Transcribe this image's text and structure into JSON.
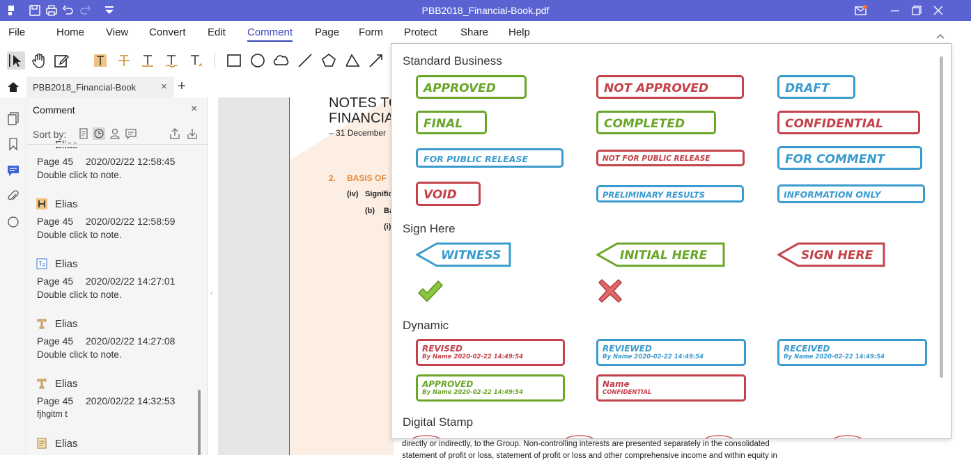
{
  "window": {
    "title": "PBB2018_Financial-Book.pdf"
  },
  "menu": {
    "items": [
      "File",
      "Home",
      "View",
      "Convert",
      "Edit",
      "Comment",
      "Page",
      "Form",
      "Protect",
      "Share",
      "Help"
    ],
    "active": "Comment"
  },
  "tabs": {
    "doc_tab": "PBB2018_Financial-Book",
    "close": "×",
    "add": "+"
  },
  "panel": {
    "title": "Comment",
    "close": "×",
    "sort_by": "Sort by:",
    "comments": [
      {
        "author": "Elias",
        "page": "Page 45",
        "time": "2020/02/22 12:58:45",
        "note": "Double click to note.",
        "icon": "highlight-icon"
      },
      {
        "author": "Elias",
        "page": "Page 45",
        "time": "2020/02/22 12:58:59",
        "note": "Double click to note.",
        "icon": "highlight-icon"
      },
      {
        "author": "Elias",
        "page": "Page 45",
        "time": "2020/02/22 14:27:01",
        "note": "Double click to note.",
        "icon": "textbox-icon"
      },
      {
        "author": "Elias",
        "page": "Page 45",
        "time": "2020/02/22 14:27:08",
        "note": "Double click to note.",
        "icon": "text-markup-icon"
      },
      {
        "author": "Elias",
        "page": "Page 45",
        "time": "2020/02/22 14:32:53",
        "note": "fjhgitm t",
        "icon": "text-markup-icon"
      },
      {
        "author": "Elias",
        "icon": "note-icon"
      }
    ]
  },
  "document": {
    "heading1": "NOTES TO",
    "heading2": "FINANCIA",
    "date_line": "– 31 December",
    "section_num": "2.",
    "section_title": "BASIS OF",
    "item_iv": "(iv)",
    "item_iv_text": "Signific",
    "item_b": "(b)",
    "item_b_text": "Ba",
    "item_i": "(i)",
    "bottom_line1": "directly or indirectly, to the Group. Non-controlling interests are presented separately in the consolidated",
    "bottom_line2": "statement of profit or loss, statement of profit or loss and other comprehensive income and within equity in"
  },
  "stamps": {
    "standard_business_title": "Standard Business",
    "standard": [
      {
        "label": "APPROVED",
        "color": "#6aa628"
      },
      {
        "label": "NOT APPROVED",
        "color": "#c4424a"
      },
      {
        "label": "DRAFT",
        "color": "#3a9bcf"
      },
      {
        "label": "FINAL",
        "color": "#6aa628"
      },
      {
        "label": "COMPLETED",
        "color": "#6aa628"
      },
      {
        "label": "CONFIDENTIAL",
        "color": "#c4424a"
      },
      {
        "label": "FOR PUBLIC RELEASE",
        "color": "#3a9bcf"
      },
      {
        "label": "NOT FOR PUBLIC RELEASE",
        "color": "#c4424a"
      },
      {
        "label": "FOR COMMENT",
        "color": "#3a9bcf"
      },
      {
        "label": "VOID",
        "color": "#c4424a"
      },
      {
        "label": "PRELIMINARY RESULTS",
        "color": "#3a9bcf"
      },
      {
        "label": "INFORMATION ONLY",
        "color": "#3a9bcf"
      }
    ],
    "sign_here_title": "Sign Here",
    "sign": [
      {
        "label": "WITNESS",
        "color": "#3a9bcf"
      },
      {
        "label": "INITIAL HERE",
        "color": "#6aa628"
      },
      {
        "label": "SIGN HERE",
        "color": "#c4424a"
      }
    ],
    "dynamic_title": "Dynamic",
    "dynamic": [
      {
        "label": "REVISED",
        "sub": "By Name 2020-02-22 14:49:54",
        "color": "#c4424a"
      },
      {
        "label": "REVIEWED",
        "sub": "By Name 2020-02-22 14:49:54",
        "color": "#3a9bcf"
      },
      {
        "label": "RECEIVED",
        "sub": "By Name 2020-02-22 14:49:54",
        "color": "#3a9bcf"
      },
      {
        "label": "APPROVED",
        "sub": "By Name 2020-02-22 14:49:54",
        "color": "#6aa628"
      },
      {
        "label": "Name",
        "sub": "CONFIDENTIAL",
        "color": "#c4424a"
      }
    ],
    "digital_title": "Digital Stamp"
  }
}
